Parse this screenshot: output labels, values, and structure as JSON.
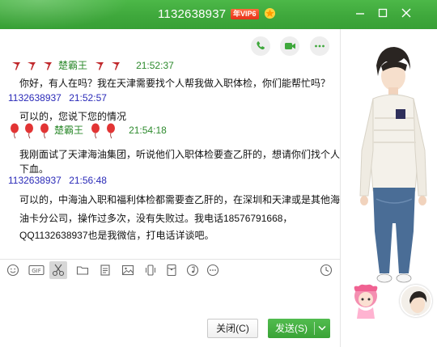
{
  "window": {
    "title": "1132638937",
    "vip_badge": "年VIP6"
  },
  "messages": [
    {
      "kind": "me",
      "decoration": "ribbons",
      "sender": "楚霸王",
      "time": "21:52:37",
      "lines": [
        "你好，有人在吗？我在天津需要找个人帮我做入职体检，你们能帮忙吗？"
      ]
    },
    {
      "kind": "other",
      "sender": "1132638937",
      "time": "21:52:57",
      "lines": [
        "可以的，您说下您的情况"
      ]
    },
    {
      "kind": "me",
      "decoration": "balloons",
      "sender": "楚霸王",
      "time": "21:54:18",
      "lines": [
        "我刚面试了天津海油集团，听说他们入职体检要查乙肝的，想请你们找个人帮我抽",
        "下血。"
      ]
    },
    {
      "kind": "other",
      "sender": "1132638937",
      "time": "21:56:48",
      "lines": [
        "可以的，中海油入职和福利体检都需要查乙肝的，在深圳和天津或是其他海",
        "油卡分公司，操作过多次，没有失败过。我电话18576791668，",
        "QQ1132638937也是我微信，打电话详谈吧。"
      ]
    }
  ],
  "buttons": {
    "close": "关闭(C)",
    "send": "发送(S)"
  },
  "colors": {
    "brand_green": "#3fa83c",
    "self_name": "#2d8a2d",
    "other_name": "#2a2ab8"
  },
  "toolbar_icons": [
    "emoji-icon",
    "gif-icon",
    "screenshot-scissors-icon",
    "folder-icon",
    "file-icon",
    "image-icon",
    "shake-icon",
    "red-packet-icon",
    "music-icon",
    "more-icon",
    "history-clock-icon"
  ]
}
